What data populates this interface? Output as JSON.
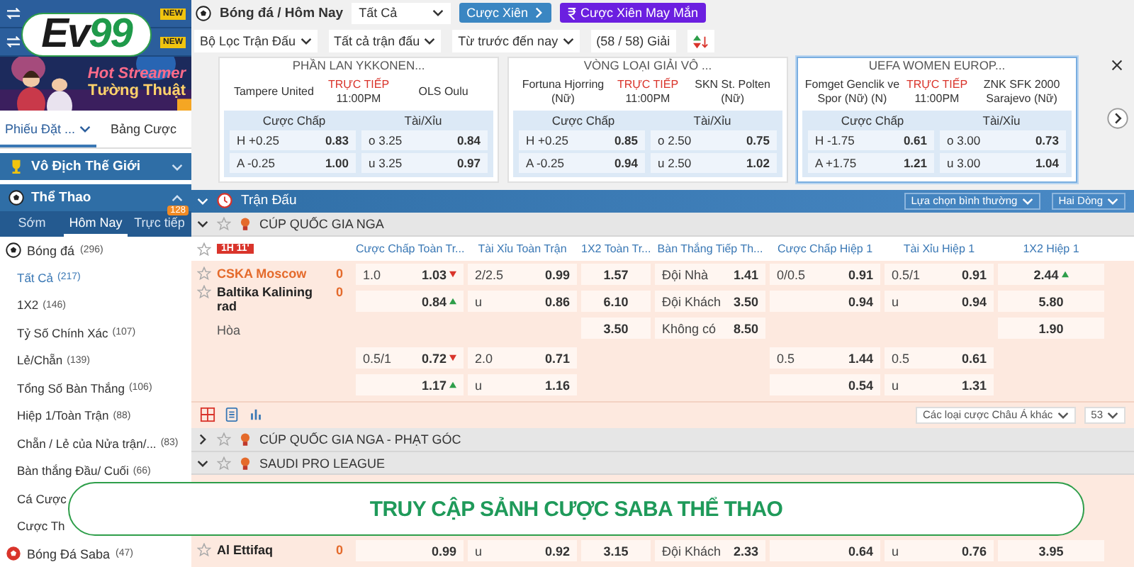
{
  "logo": {
    "prefix": "Ev",
    "suffix": "99"
  },
  "sidebar": {
    "strips": [
      {
        "badge": "NEW"
      },
      {
        "badge": "NEW"
      }
    ],
    "promo": {
      "kind": "picture",
      "lines": [
        "Hot Streamer",
        "Tường Thuật"
      ]
    },
    "tabs": [
      {
        "label": "Phiếu Đặt ...",
        "selected": true,
        "dropdown": true
      },
      {
        "label": "Bảng Cược",
        "selected": false,
        "dropdown": false
      }
    ],
    "sections": [
      {
        "label": "Vô Địch Thế Giới",
        "kind": "trophy",
        "expanded": false
      },
      {
        "label": "Thể Thao",
        "kind": "sports",
        "expanded": true
      }
    ],
    "time_tabs": [
      {
        "label": "Sớm",
        "selected": false
      },
      {
        "label": "Hôm Nay",
        "selected": true
      },
      {
        "label": "Trực tiếp",
        "selected": false,
        "badge": "128"
      }
    ],
    "sports": [
      {
        "name": "Bóng đá",
        "count": "(296)",
        "kind": "soccer",
        "children": [
          {
            "label": "Tất Cả",
            "count": "(217)",
            "selected": true
          },
          {
            "label": "1X2",
            "count": "(146)",
            "selected": false
          },
          {
            "label": "Tỷ Số Chính Xác",
            "count": "(107)",
            "selected": false
          },
          {
            "label": "Lẻ/Chẵn",
            "count": "(139)",
            "selected": false
          },
          {
            "label": "Tổng Số Bàn Thắng",
            "count": "(106)",
            "selected": false
          },
          {
            "label": "Hiệp 1/Toàn Trận",
            "count": "(88)",
            "selected": false
          },
          {
            "label": "Chẵn / Lẻ của Nửa trận/...",
            "count": "(83)",
            "selected": false
          },
          {
            "label": "Bàn thắng Đầu/ Cuối",
            "count": "(66)",
            "selected": false
          },
          {
            "label": "Cá Cược",
            "selected": false
          },
          {
            "label": "Cược Th",
            "selected": false
          }
        ]
      },
      {
        "name": "Bóng Đá Saba",
        "count": "(47)",
        "kind": "saba"
      }
    ]
  },
  "header": {
    "title": "Bóng đá / Hôm Nay",
    "select": "Tất Cả",
    "buttons": [
      {
        "label": "Cược Xiên",
        "kind": "parlay"
      },
      {
        "label": "Cược Xiên May Mắn",
        "kind": "lucky"
      }
    ]
  },
  "filters": [
    {
      "label": "Bộ Lọc Trận Đấu",
      "dropdown": true
    },
    {
      "label": "Tất cả trận đấu",
      "dropdown": true
    },
    {
      "label": "Từ trước đến nay",
      "dropdown": true
    },
    {
      "label": "(58 / 58) Giải",
      "dropdown": false
    }
  ],
  "featured": [
    {
      "league": "PHẦN LAN YKKONEN...",
      "home": "Tampere United",
      "away": "OLS Oulu",
      "status": "TRỰC TIẾP",
      "time": "11:00PM",
      "selected": false,
      "hdp_label": "Cược Chấp",
      "ou_label": "Tài/Xỉu",
      "rows": [
        {
          "hdp": "H +0.25",
          "hdp_odds": "0.83",
          "ou": "o 3.25",
          "ou_odds": "0.84"
        },
        {
          "hdp": "A -0.25",
          "hdp_odds": "1.00",
          "ou": "u 3.25",
          "ou_odds": "0.97"
        }
      ]
    },
    {
      "league": "VÒNG LOẠI GIẢI VÔ ...",
      "home": "Fortuna Hjorring (Nữ)",
      "away": "SKN St. Polten (Nữ)",
      "status": "TRỰC TIẾP",
      "time": "11:00PM",
      "selected": false,
      "hdp_label": "Cược Chấp",
      "ou_label": "Tài/Xỉu",
      "rows": [
        {
          "hdp": "H +0.25",
          "hdp_odds": "0.85",
          "ou": "o 2.50",
          "ou_odds": "0.75"
        },
        {
          "hdp": "A -0.25",
          "hdp_odds": "0.94",
          "ou": "u 2.50",
          "ou_odds": "1.02"
        }
      ]
    },
    {
      "league": "UEFA WOMEN EUROP...",
      "home": "Fomget Genclik ve Spor (Nữ) (N)",
      "away": "ZNK SFK 2000 Sarajevo (Nữ)",
      "status": "TRỰC TIẾP",
      "time": "11:00PM",
      "selected": true,
      "hdp_label": "Cược Chấp",
      "ou_label": "Tài/Xỉu",
      "rows": [
        {
          "hdp": "H -1.75",
          "hdp_odds": "0.61",
          "ou": "o 3.00",
          "ou_odds": "0.73"
        },
        {
          "hdp": "A +1.75",
          "hdp_odds": "1.21",
          "ou": "u 3.00",
          "ou_odds": "1.04"
        }
      ]
    }
  ],
  "matches": {
    "title": "Trận Đấu",
    "options": [
      "Lựa chọn bình thường",
      "Hai Dòng"
    ],
    "leagues": [
      {
        "name": "CÚP QUỐC GIA NGA",
        "expanded": true,
        "live": "1H 11'",
        "columns": [
          "Cược Chấp Toàn Tr...",
          "Tài Xỉu Toàn Trận",
          "1X2 Toàn Tr...",
          "Bàn Thắng Tiếp Th...",
          "Cược Chấp Hiệp 1",
          "Tài Xỉu Hiệp 1",
          "1X2 Hiệp 1"
        ],
        "teams": [
          {
            "name": "CSKA Moscow",
            "score": "0",
            "favorite": true
          },
          {
            "name": "Baltika Kalining rad",
            "score": "0",
            "favorite": false
          },
          {
            "name": "Hòa"
          }
        ],
        "groups": [
          [
            [
              {
                "line": "1.0",
                "odds": "1.03",
                "rising": false
              },
              {
                "line": "2/2.5",
                "odds": "0.99"
              },
              {
                "odds": "1.57"
              },
              {
                "line": "Đội Nhà",
                "odds": "1.41"
              },
              {
                "line": "0/0.5",
                "odds": "0.91"
              },
              {
                "line": "0.5/1",
                "odds": "0.91"
              },
              {
                "odds": "2.44",
                "rising": true
              }
            ],
            [
              {
                "odds": "0.84",
                "rising": true
              },
              {
                "line": "u",
                "odds": "0.86"
              },
              {
                "odds": "6.10"
              },
              {
                "line": "Đội Khách",
                "odds": "3.50"
              },
              {
                "odds": "0.94"
              },
              {
                "line": "u",
                "odds": "0.94"
              },
              {
                "odds": "5.80"
              }
            ],
            [
              {
                "kind": "empty"
              },
              {
                "kind": "empty"
              },
              {
                "odds": "3.50"
              },
              {
                "line": "Không có",
                "odds": "8.50"
              },
              {
                "kind": "empty"
              },
              {
                "kind": "empty"
              },
              {
                "odds": "1.90"
              }
            ]
          ],
          [
            [
              {
                "line": "0.5/1",
                "odds": "0.72",
                "rising": false
              },
              {
                "line": "2.0",
                "odds": "0.71"
              },
              {
                "kind": "empty"
              },
              {
                "kind": "empty"
              },
              {
                "line": "0.5",
                "odds": "1.44"
              },
              {
                "line": "0.5",
                "odds": "0.61"
              },
              {
                "kind": "empty"
              }
            ],
            [
              {
                "odds": "1.17",
                "rising": true
              },
              {
                "line": "u",
                "odds": "1.16"
              },
              {
                "kind": "empty"
              },
              {
                "kind": "empty"
              },
              {
                "odds": "0.54"
              },
              {
                "line": "u",
                "odds": "1.31"
              },
              {
                "kind": "empty"
              }
            ]
          ]
        ],
        "footer": {
          "other": "Các loại cược Châu Á khác",
          "count": "53"
        }
      },
      {
        "name": "CÚP QUỐC GIA NGA - PHẠT GÓC",
        "expanded": false
      },
      {
        "name": "SAUDI PRO LEAGUE",
        "expanded": true,
        "teams": [
          {
            "name": "Al Ettifaq",
            "score": "0",
            "favorite": false
          }
        ],
        "groups": [
          [
            [
              {
                "odds": "0.99"
              },
              {
                "line": "u",
                "odds": "0.92"
              },
              {
                "odds": "3.15"
              },
              {
                "line": "Đội Khách",
                "odds": "2.33"
              },
              {
                "odds": "0.64"
              },
              {
                "line": "u",
                "odds": "0.76"
              },
              {
                "odds": "3.95"
              }
            ]
          ]
        ]
      }
    ]
  },
  "banner": {
    "text": "TRUY CẬP SẢNH CƯỢC SABA THỂ THAO"
  }
}
